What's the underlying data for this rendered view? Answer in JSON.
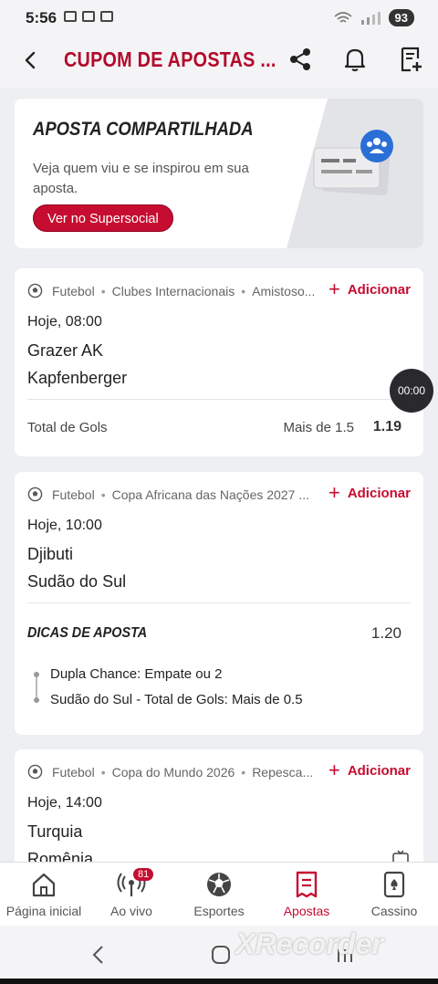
{
  "status": {
    "time": "5:56",
    "battery": "93"
  },
  "header": {
    "title": "CUPOM DE APOSTAS ..."
  },
  "promo": {
    "title": "APOSTA COMPARTILHADA",
    "text": "Veja quem viu e se inspirou em sua aposta.",
    "button_label": "Ver no Supersocial"
  },
  "events": [
    {
      "sport": "Futebol",
      "competition": "Clubes Internacionais",
      "extra": "Amistoso...",
      "add_label": "Adicionar",
      "time": "Hoje, 08:00",
      "home": "Grazer AK",
      "away": "Kapfenberger",
      "market": "Total de Gols",
      "selection": "Mais de 1.5",
      "odd": "1.19"
    },
    {
      "sport": "Futebol",
      "competition": "Copa Africana das Nações 2027 ...",
      "add_label": "Adicionar",
      "time": "Hoje, 10:00",
      "home": "Djibuti",
      "away": "Sudão do Sul",
      "tips_title": "DICAS DE APOSTA",
      "tips_odd": "1.20",
      "tips": [
        "Dupla Chance: Empate ou 2",
        "Sudão do Sul - Total de Gols: Mais de 0.5"
      ]
    },
    {
      "sport": "Futebol",
      "competition": "Copa do Mundo 2026",
      "extra": "Repesca...",
      "add_label": "Adicionar",
      "time": "Hoje, 14:00",
      "home": "Turquia",
      "away": "Romênia"
    }
  ],
  "timer": "00:00",
  "nav": [
    {
      "label": "Página inicial",
      "icon": "home-icon"
    },
    {
      "label": "Ao vivo",
      "icon": "live-icon",
      "badge": "81"
    },
    {
      "label": "Esportes",
      "icon": "soccer-ball-icon"
    },
    {
      "label": "Apostas",
      "icon": "betslip-icon",
      "active": true
    },
    {
      "label": "Cassino",
      "icon": "cards-icon"
    }
  ],
  "watermark": "XRecorder",
  "colors": {
    "brand": "#c60c30",
    "background": "#eeeff2"
  }
}
